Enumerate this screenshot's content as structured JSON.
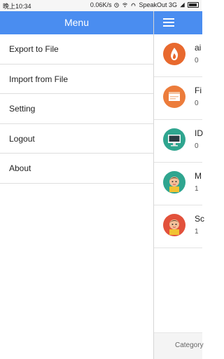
{
  "status_bar": {
    "left": "晚上10:34",
    "speed": "0.06K/s",
    "carrier": "SpeakOut 3G"
  },
  "drawer": {
    "title": "Menu",
    "items": [
      {
        "label": "Export to File"
      },
      {
        "label": "Import from File"
      },
      {
        "label": "Setting"
      },
      {
        "label": "Logout"
      },
      {
        "label": "About"
      }
    ]
  },
  "background": {
    "rows": [
      {
        "title": "ai",
        "count": "0",
        "icon": "fire-icon",
        "color": "#e8692e"
      },
      {
        "title": "Fi",
        "count": "0",
        "icon": "browser-icon",
        "color": "#ec7c3b"
      },
      {
        "title": "ID",
        "count": "0",
        "icon": "monitor-icon",
        "color": "#2fa58f"
      },
      {
        "title": "M",
        "count": "1",
        "icon": "person-icon",
        "color": "#2fa58f"
      },
      {
        "title": "Sc",
        "count": "1",
        "icon": "person-icon",
        "color": "#e2513b"
      }
    ],
    "bottom_label": "Category"
  },
  "colors": {
    "accent": "#4a8df0"
  }
}
